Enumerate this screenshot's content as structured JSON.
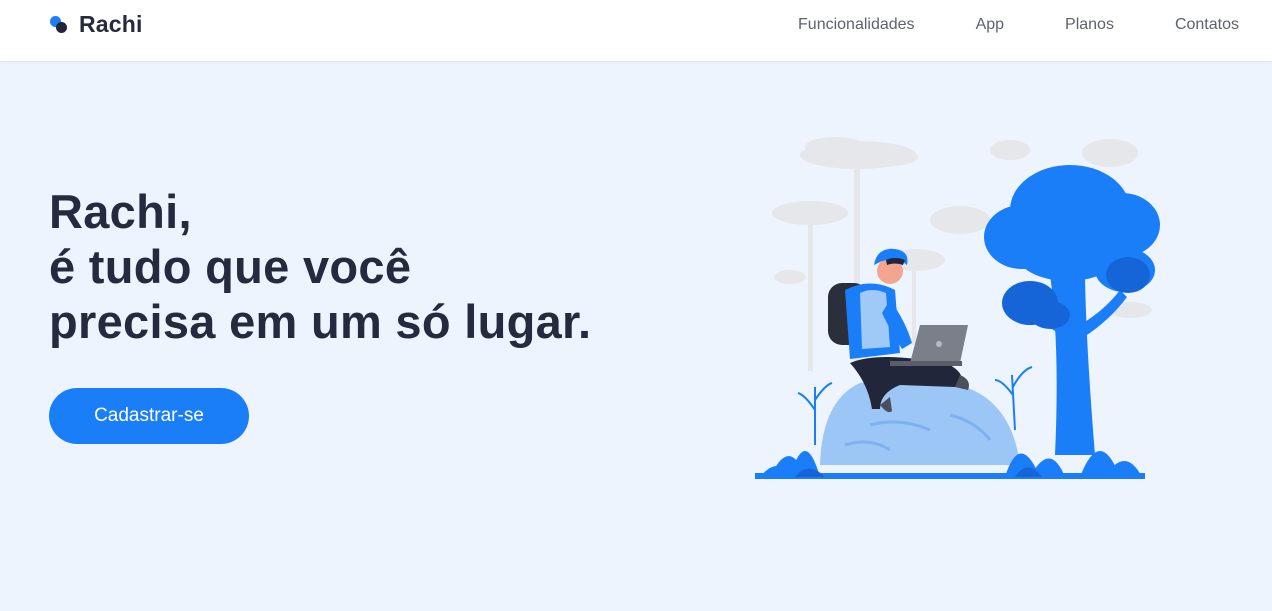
{
  "brand": {
    "name": "Rachi",
    "accent_color": "#1a7ef8",
    "dark_color": "#262a3d",
    "background_color": "#edf4fd"
  },
  "nav": {
    "items": [
      {
        "label": "Funcionalidades"
      },
      {
        "label": "App"
      },
      {
        "label": "Planos"
      },
      {
        "label": "Contatos"
      }
    ]
  },
  "hero": {
    "title_lines": [
      "Rachi,",
      "é tudo que você",
      "precisa em um só lugar."
    ],
    "cta_label": "Cadastrar-se"
  },
  "illustration": {
    "icon": "person-with-laptop-in-forest-illustration"
  }
}
